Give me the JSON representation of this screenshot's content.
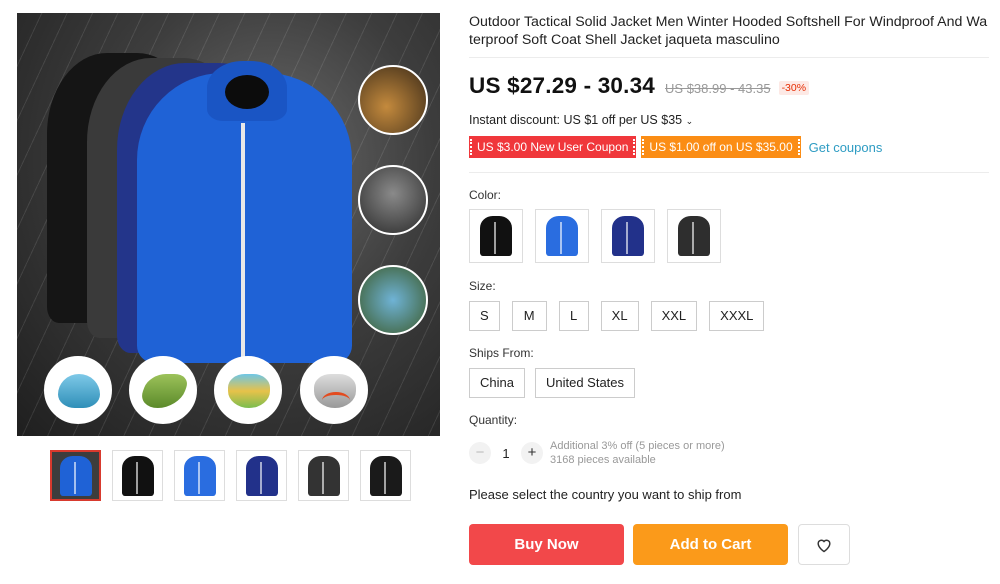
{
  "product": {
    "title": "Outdoor Tactical Solid Jacket Men Winter Hooded Softshell For Windproof And Waterproof Soft Coat Shell Jacket jaqueta masculino",
    "price": "US $27.29 - 30.34",
    "original_price": "US $38.99 - 43.35",
    "discount_badge": "-30%",
    "instant_discount": "Instant discount: US $1 off per US $35",
    "coupons": [
      {
        "label": "US $3.00 New User Coupon",
        "color": "#f0373b"
      },
      {
        "label": "US $1.00 off on US $35.00",
        "color": "#fb8d15"
      }
    ],
    "get_coupons_label": "Get coupons"
  },
  "gallery": {
    "thumbnails": [
      {
        "color_name": "blue-collage",
        "color": "#1f62d6",
        "active": true
      },
      {
        "color_name": "black",
        "color": "#111111",
        "active": false
      },
      {
        "color_name": "blue",
        "color": "#2a6de0",
        "active": false
      },
      {
        "color_name": "navy",
        "color": "#22318a",
        "active": false
      },
      {
        "color_name": "dark-grey",
        "color": "#333333",
        "active": false
      },
      {
        "color_name": "black-2",
        "color": "#1a1a1a",
        "active": false
      }
    ]
  },
  "options": {
    "color_label": "Color:",
    "colors": [
      {
        "name": "black",
        "swatch": "#111111"
      },
      {
        "name": "blue",
        "swatch": "#2a6de0"
      },
      {
        "name": "navy",
        "swatch": "#22318a"
      },
      {
        "name": "dark-grey",
        "swatch": "#2e2e2e"
      }
    ],
    "size_label": "Size:",
    "sizes": [
      "S",
      "M",
      "L",
      "XL",
      "XXL",
      "XXXL"
    ],
    "ships_label": "Ships From:",
    "ships_from": [
      "China",
      "United States"
    ],
    "quantity_label": "Quantity:",
    "quantity_value": "1",
    "quantity_minus": "−",
    "quantity_plus": "+",
    "additional_discount": "Additional 3% off (5 pieces or more)",
    "pieces_available": "3168 pieces available"
  },
  "shipping_note": "Please select the country you want to ship from",
  "actions": {
    "buy_now": "Buy Now",
    "add_to_cart": "Add to Cart",
    "wishlist_icon": "heart-icon"
  }
}
